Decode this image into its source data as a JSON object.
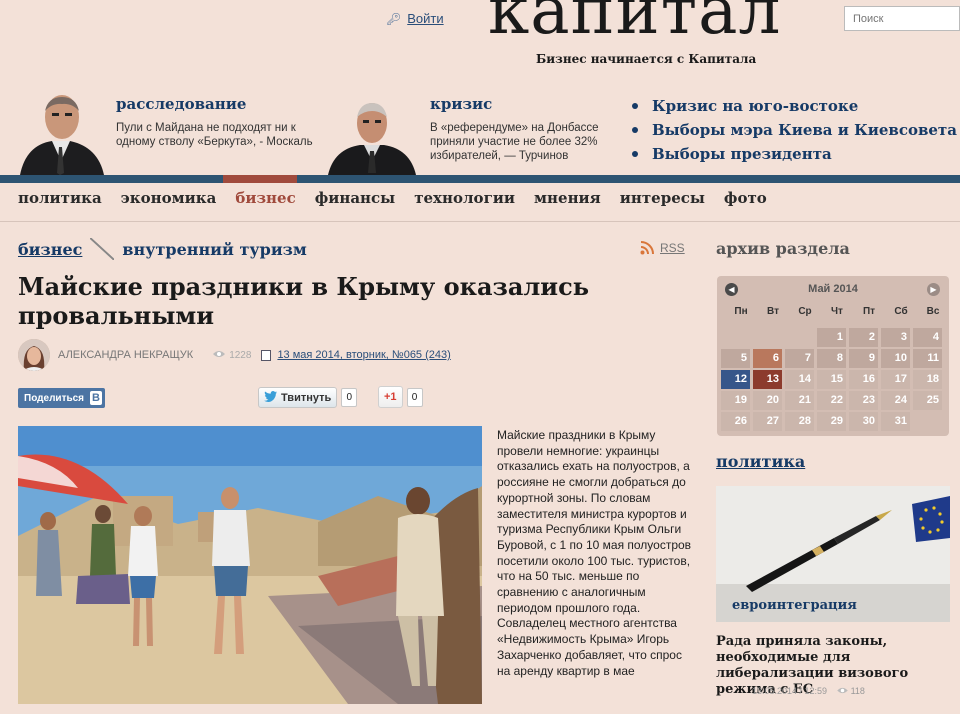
{
  "header": {
    "login_label": "Войти",
    "logo": "капитал",
    "tagline": "Бизнес начинается с Капитала",
    "search_placeholder": "Поиск"
  },
  "featured": [
    {
      "title": "расследование",
      "text": "Пули с Майдана не подходят ни к одному стволу «Беркута», - Москаль"
    },
    {
      "title": "кризис",
      "text": "В «референдуме» на Донбассе приняли участие не более 32% избирателей, — Турчинов"
    }
  ],
  "hot_links": [
    "Кризис на юго-востоке",
    "Выборы мэра Киева и Киевсовета",
    "Выборы президента"
  ],
  "nav": {
    "items": [
      "политика",
      "экономика",
      "бизнес",
      "финансы",
      "технологии",
      "мнения",
      "интересы",
      "фото"
    ],
    "active": "бизнес"
  },
  "article": {
    "breadcrumb": [
      "бизнес",
      "внутренний туризм"
    ],
    "rss": "RSS",
    "title": "Майские праздники в Крыму оказались провальными",
    "author": "АЛЕКСАНДРА НЕКРАЩУК",
    "views": "1228",
    "issue": "13 мая 2014, вторник, №065 (243)",
    "share_label": "Поделиться",
    "share_vk": "В",
    "tweet_label": "Твитнуть",
    "tweet_count": "0",
    "gplus_label": "+1",
    "gplus_count": "0",
    "body": "Майские праздники в Крыму провели немногие: украинцы отказались ехать на полуостров, а россияне не смогли добраться до курортной зоны. По словам заместителя министра курортов и туризма Республики Крым Ольги Буровой, с 1 по 10 мая полуостров посетили около 100 тыс. туристов, что на 50 тыс. меньше по сравнению с аналогичным периодом прошлого года. Совладелец местного агентства «Недвижимость Крыма» Игорь Захарченко добавляет, что спрос на аренду квартир в мае"
  },
  "archive": {
    "title": "архив раздела",
    "month": "Май 2014",
    "weekdays": [
      "Пн",
      "Вт",
      "Ср",
      "Чт",
      "Пт",
      "Сб",
      "Вс"
    ],
    "offset": 3,
    "days": 31,
    "selected_day": 12,
    "current_day": 13
  },
  "sidebar_news": {
    "section": "политика",
    "tag": "евроинтеграция",
    "headline": "Рада приняла законы, необходимые для либерализации визового режима с ЕС",
    "date": "13.05.2014 / 12:59",
    "views": "118"
  },
  "colors": {
    "background": "#f3e1d8",
    "link_blue": "#163a66",
    "accent_red": "#a04a3c",
    "nav_bar": "#2d5472"
  }
}
